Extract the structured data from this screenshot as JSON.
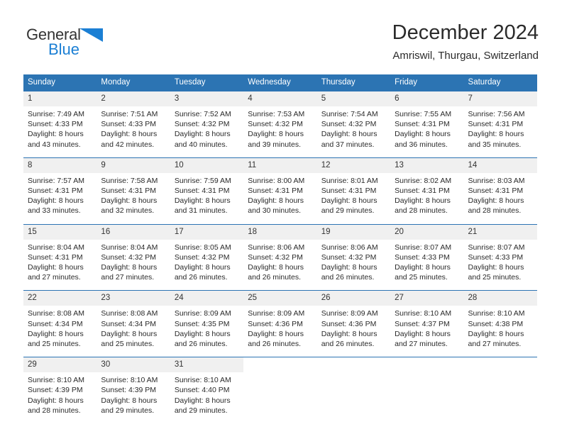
{
  "brand": {
    "name_part1": "General",
    "name_part2": "Blue",
    "triangle_color": "#1b7fd4"
  },
  "header": {
    "title": "December 2024",
    "subtitle": "Amriswil, Thurgau, Switzerland"
  },
  "colors": {
    "header_blue": "#2c74b3",
    "daynum_band": "#f0f0f0",
    "text": "#2a2a2a"
  },
  "weekday_headers": [
    "Sunday",
    "Monday",
    "Tuesday",
    "Wednesday",
    "Thursday",
    "Friday",
    "Saturday"
  ],
  "weeks": [
    [
      {
        "day": "1",
        "sunrise": "Sunrise: 7:49 AM",
        "sunset": "Sunset: 4:33 PM",
        "daylight_line1": "Daylight: 8 hours",
        "daylight_line2": "and 43 minutes."
      },
      {
        "day": "2",
        "sunrise": "Sunrise: 7:51 AM",
        "sunset": "Sunset: 4:33 PM",
        "daylight_line1": "Daylight: 8 hours",
        "daylight_line2": "and 42 minutes."
      },
      {
        "day": "3",
        "sunrise": "Sunrise: 7:52 AM",
        "sunset": "Sunset: 4:32 PM",
        "daylight_line1": "Daylight: 8 hours",
        "daylight_line2": "and 40 minutes."
      },
      {
        "day": "4",
        "sunrise": "Sunrise: 7:53 AM",
        "sunset": "Sunset: 4:32 PM",
        "daylight_line1": "Daylight: 8 hours",
        "daylight_line2": "and 39 minutes."
      },
      {
        "day": "5",
        "sunrise": "Sunrise: 7:54 AM",
        "sunset": "Sunset: 4:32 PM",
        "daylight_line1": "Daylight: 8 hours",
        "daylight_line2": "and 37 minutes."
      },
      {
        "day": "6",
        "sunrise": "Sunrise: 7:55 AM",
        "sunset": "Sunset: 4:31 PM",
        "daylight_line1": "Daylight: 8 hours",
        "daylight_line2": "and 36 minutes."
      },
      {
        "day": "7",
        "sunrise": "Sunrise: 7:56 AM",
        "sunset": "Sunset: 4:31 PM",
        "daylight_line1": "Daylight: 8 hours",
        "daylight_line2": "and 35 minutes."
      }
    ],
    [
      {
        "day": "8",
        "sunrise": "Sunrise: 7:57 AM",
        "sunset": "Sunset: 4:31 PM",
        "daylight_line1": "Daylight: 8 hours",
        "daylight_line2": "and 33 minutes."
      },
      {
        "day": "9",
        "sunrise": "Sunrise: 7:58 AM",
        "sunset": "Sunset: 4:31 PM",
        "daylight_line1": "Daylight: 8 hours",
        "daylight_line2": "and 32 minutes."
      },
      {
        "day": "10",
        "sunrise": "Sunrise: 7:59 AM",
        "sunset": "Sunset: 4:31 PM",
        "daylight_line1": "Daylight: 8 hours",
        "daylight_line2": "and 31 minutes."
      },
      {
        "day": "11",
        "sunrise": "Sunrise: 8:00 AM",
        "sunset": "Sunset: 4:31 PM",
        "daylight_line1": "Daylight: 8 hours",
        "daylight_line2": "and 30 minutes."
      },
      {
        "day": "12",
        "sunrise": "Sunrise: 8:01 AM",
        "sunset": "Sunset: 4:31 PM",
        "daylight_line1": "Daylight: 8 hours",
        "daylight_line2": "and 29 minutes."
      },
      {
        "day": "13",
        "sunrise": "Sunrise: 8:02 AM",
        "sunset": "Sunset: 4:31 PM",
        "daylight_line1": "Daylight: 8 hours",
        "daylight_line2": "and 28 minutes."
      },
      {
        "day": "14",
        "sunrise": "Sunrise: 8:03 AM",
        "sunset": "Sunset: 4:31 PM",
        "daylight_line1": "Daylight: 8 hours",
        "daylight_line2": "and 28 minutes."
      }
    ],
    [
      {
        "day": "15",
        "sunrise": "Sunrise: 8:04 AM",
        "sunset": "Sunset: 4:31 PM",
        "daylight_line1": "Daylight: 8 hours",
        "daylight_line2": "and 27 minutes."
      },
      {
        "day": "16",
        "sunrise": "Sunrise: 8:04 AM",
        "sunset": "Sunset: 4:32 PM",
        "daylight_line1": "Daylight: 8 hours",
        "daylight_line2": "and 27 minutes."
      },
      {
        "day": "17",
        "sunrise": "Sunrise: 8:05 AM",
        "sunset": "Sunset: 4:32 PM",
        "daylight_line1": "Daylight: 8 hours",
        "daylight_line2": "and 26 minutes."
      },
      {
        "day": "18",
        "sunrise": "Sunrise: 8:06 AM",
        "sunset": "Sunset: 4:32 PM",
        "daylight_line1": "Daylight: 8 hours",
        "daylight_line2": "and 26 minutes."
      },
      {
        "day": "19",
        "sunrise": "Sunrise: 8:06 AM",
        "sunset": "Sunset: 4:32 PM",
        "daylight_line1": "Daylight: 8 hours",
        "daylight_line2": "and 26 minutes."
      },
      {
        "day": "20",
        "sunrise": "Sunrise: 8:07 AM",
        "sunset": "Sunset: 4:33 PM",
        "daylight_line1": "Daylight: 8 hours",
        "daylight_line2": "and 25 minutes."
      },
      {
        "day": "21",
        "sunrise": "Sunrise: 8:07 AM",
        "sunset": "Sunset: 4:33 PM",
        "daylight_line1": "Daylight: 8 hours",
        "daylight_line2": "and 25 minutes."
      }
    ],
    [
      {
        "day": "22",
        "sunrise": "Sunrise: 8:08 AM",
        "sunset": "Sunset: 4:34 PM",
        "daylight_line1": "Daylight: 8 hours",
        "daylight_line2": "and 25 minutes."
      },
      {
        "day": "23",
        "sunrise": "Sunrise: 8:08 AM",
        "sunset": "Sunset: 4:34 PM",
        "daylight_line1": "Daylight: 8 hours",
        "daylight_line2": "and 25 minutes."
      },
      {
        "day": "24",
        "sunrise": "Sunrise: 8:09 AM",
        "sunset": "Sunset: 4:35 PM",
        "daylight_line1": "Daylight: 8 hours",
        "daylight_line2": "and 26 minutes."
      },
      {
        "day": "25",
        "sunrise": "Sunrise: 8:09 AM",
        "sunset": "Sunset: 4:36 PM",
        "daylight_line1": "Daylight: 8 hours",
        "daylight_line2": "and 26 minutes."
      },
      {
        "day": "26",
        "sunrise": "Sunrise: 8:09 AM",
        "sunset": "Sunset: 4:36 PM",
        "daylight_line1": "Daylight: 8 hours",
        "daylight_line2": "and 26 minutes."
      },
      {
        "day": "27",
        "sunrise": "Sunrise: 8:10 AM",
        "sunset": "Sunset: 4:37 PM",
        "daylight_line1": "Daylight: 8 hours",
        "daylight_line2": "and 27 minutes."
      },
      {
        "day": "28",
        "sunrise": "Sunrise: 8:10 AM",
        "sunset": "Sunset: 4:38 PM",
        "daylight_line1": "Daylight: 8 hours",
        "daylight_line2": "and 27 minutes."
      }
    ],
    [
      {
        "day": "29",
        "sunrise": "Sunrise: 8:10 AM",
        "sunset": "Sunset: 4:39 PM",
        "daylight_line1": "Daylight: 8 hours",
        "daylight_line2": "and 28 minutes."
      },
      {
        "day": "30",
        "sunrise": "Sunrise: 8:10 AM",
        "sunset": "Sunset: 4:39 PM",
        "daylight_line1": "Daylight: 8 hours",
        "daylight_line2": "and 29 minutes."
      },
      {
        "day": "31",
        "sunrise": "Sunrise: 8:10 AM",
        "sunset": "Sunset: 4:40 PM",
        "daylight_line1": "Daylight: 8 hours",
        "daylight_line2": "and 29 minutes."
      },
      {
        "day": "",
        "sunrise": "",
        "sunset": "",
        "daylight_line1": "",
        "daylight_line2": ""
      },
      {
        "day": "",
        "sunrise": "",
        "sunset": "",
        "daylight_line1": "",
        "daylight_line2": ""
      },
      {
        "day": "",
        "sunrise": "",
        "sunset": "",
        "daylight_line1": "",
        "daylight_line2": ""
      },
      {
        "day": "",
        "sunrise": "",
        "sunset": "",
        "daylight_line1": "",
        "daylight_line2": ""
      }
    ]
  ]
}
